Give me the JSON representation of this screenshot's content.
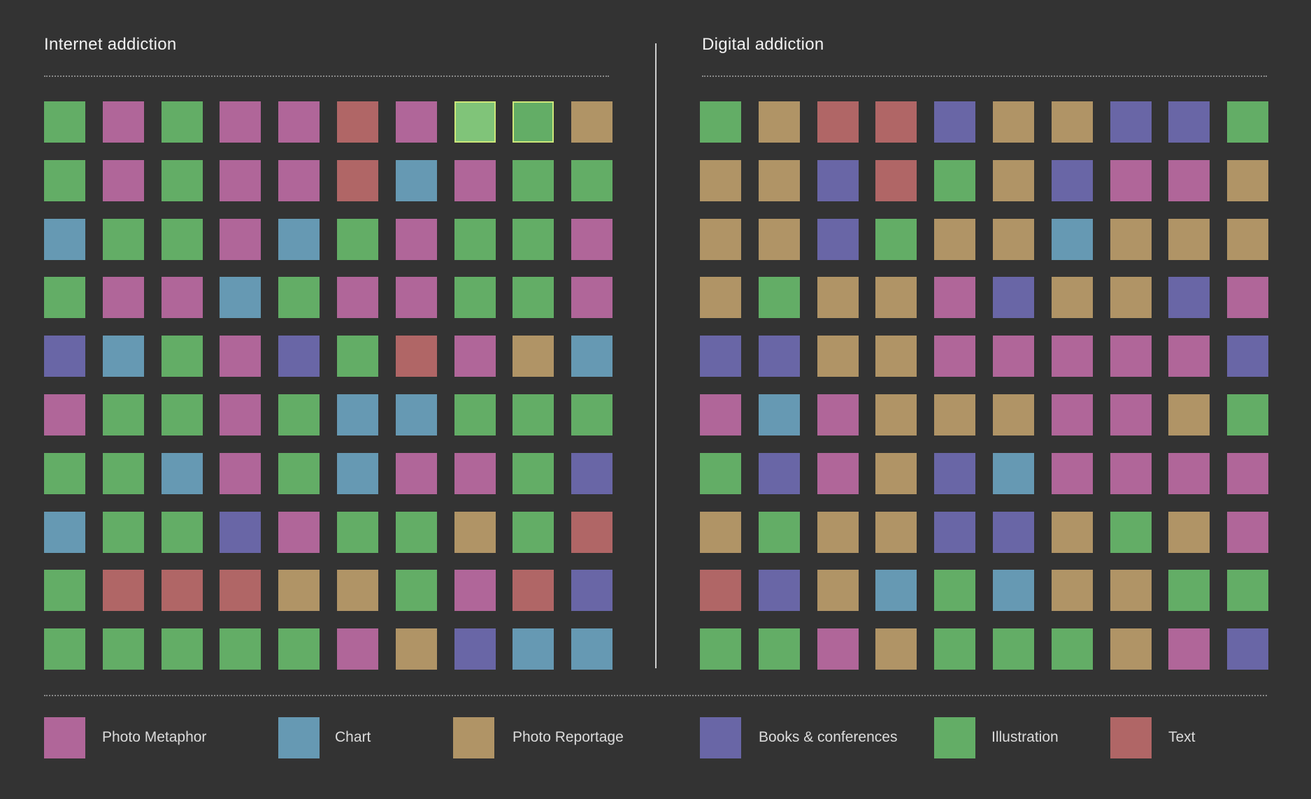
{
  "panels": [
    {
      "title": "Internet addiction"
    },
    {
      "title": "Digital addiction"
    }
  ],
  "legend": [
    {
      "key": "P",
      "label": "Photo Metaphor",
      "color": "#b06699"
    },
    {
      "key": "C",
      "label": "Chart",
      "color": "#6699b3"
    },
    {
      "key": "R",
      "label": "Photo Reportage",
      "color": "#b09466"
    },
    {
      "key": "B",
      "label": "Books & conferences",
      "color": "#6966a6"
    },
    {
      "key": "I",
      "label": "Illustration",
      "color": "#63ad66"
    },
    {
      "key": "T",
      "label": "Text",
      "color": "#b06666"
    }
  ],
  "chart_data": {
    "type": "heatmap",
    "categories": [
      "Photo Metaphor",
      "Chart",
      "Photo Reportage",
      "Books & conferences",
      "Illustration",
      "Text"
    ],
    "grids": [
      {
        "title": "Internet addiction",
        "rows": [
          [
            "I",
            "P",
            "I",
            "P",
            "P",
            "T",
            "P",
            "I",
            "I",
            "R"
          ],
          [
            "I",
            "P",
            "I",
            "P",
            "P",
            "T",
            "C",
            "P",
            "I",
            "I"
          ],
          [
            "C",
            "I",
            "I",
            "P",
            "C",
            "I",
            "P",
            "I",
            "I",
            "P"
          ],
          [
            "I",
            "P",
            "P",
            "C",
            "I",
            "P",
            "P",
            "I",
            "I",
            "P"
          ],
          [
            "B",
            "C",
            "I",
            "P",
            "B",
            "I",
            "T",
            "P",
            "R",
            "C"
          ],
          [
            "P",
            "I",
            "I",
            "P",
            "I",
            "C",
            "C",
            "I",
            "I",
            "I"
          ],
          [
            "I",
            "I",
            "C",
            "P",
            "I",
            "C",
            "P",
            "P",
            "I",
            "B"
          ],
          [
            "C",
            "I",
            "I",
            "B",
            "P",
            "I",
            "I",
            "R",
            "I",
            "T"
          ],
          [
            "I",
            "T",
            "T",
            "T",
            "R",
            "R",
            "I",
            "P",
            "T",
            "B"
          ],
          [
            "I",
            "I",
            "I",
            "I",
            "I",
            "P",
            "R",
            "B",
            "C",
            "C"
          ]
        ],
        "highlighted": [
          [
            0,
            7
          ],
          [
            0,
            8
          ]
        ]
      },
      {
        "title": "Digital addiction",
        "rows": [
          [
            "I",
            "R",
            "T",
            "T",
            "B",
            "R",
            "R",
            "B",
            "B",
            "I"
          ],
          [
            "R",
            "R",
            "B",
            "T",
            "I",
            "R",
            "B",
            "P",
            "P",
            "R"
          ],
          [
            "R",
            "R",
            "B",
            "I",
            "R",
            "R",
            "C",
            "R",
            "R",
            "R"
          ],
          [
            "R",
            "I",
            "R",
            "R",
            "P",
            "B",
            "R",
            "R",
            "B",
            "P"
          ],
          [
            "B",
            "B",
            "R",
            "R",
            "P",
            "P",
            "P",
            "P",
            "P",
            "B"
          ],
          [
            "P",
            "C",
            "P",
            "R",
            "R",
            "R",
            "P",
            "P",
            "R",
            "I"
          ],
          [
            "I",
            "B",
            "P",
            "R",
            "B",
            "C",
            "P",
            "P",
            "P",
            "P"
          ],
          [
            "R",
            "I",
            "R",
            "R",
            "B",
            "B",
            "R",
            "I",
            "R",
            "P"
          ],
          [
            "T",
            "B",
            "R",
            "C",
            "I",
            "C",
            "R",
            "R",
            "I",
            "I"
          ],
          [
            "I",
            "I",
            "P",
            "R",
            "I",
            "I",
            "I",
            "R",
            "P",
            "B"
          ]
        ],
        "highlighted": []
      }
    ]
  }
}
